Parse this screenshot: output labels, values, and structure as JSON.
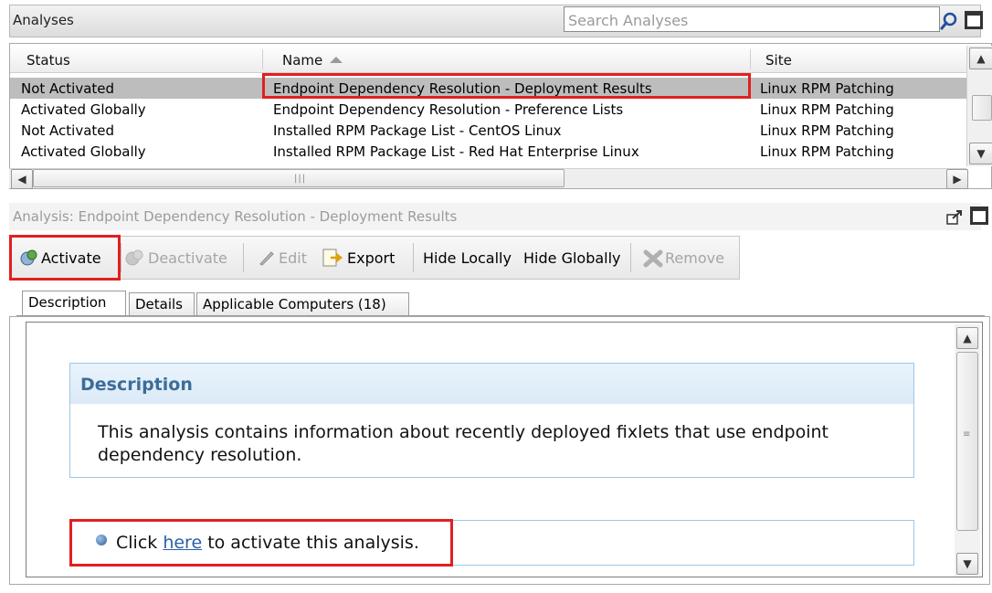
{
  "header": {
    "title": "Analyses",
    "search_placeholder": "Search Analyses"
  },
  "list": {
    "columns": [
      "Status",
      "Name",
      "Site"
    ],
    "rows": [
      {
        "status": "Not Activated",
        "name": "Endpoint Dependency Resolution - Deployment Results",
        "site": "Linux RPM Patching",
        "selected": true
      },
      {
        "status": "Activated Globally",
        "name": "Endpoint Dependency Resolution - Preference Lists",
        "site": "Linux RPM Patching",
        "selected": false
      },
      {
        "status": "Not Activated",
        "name": "Installed RPM Package List - CentOS Linux",
        "site": "Linux RPM Patching",
        "selected": false
      },
      {
        "status": "Activated Globally",
        "name": "Installed RPM Package List - Red Hat Enterprise Linux",
        "site": "Linux RPM Patching",
        "selected": false
      }
    ]
  },
  "analysis": {
    "title": "Analysis: Endpoint Dependency Resolution - Deployment Results"
  },
  "toolbar": {
    "activate": "Activate",
    "deactivate": "Deactivate",
    "edit": "Edit",
    "export": "Export",
    "hide_locally": "Hide Locally",
    "hide_globally": "Hide Globally",
    "remove": "Remove"
  },
  "tabs": [
    "Description",
    "Details",
    "Applicable Computers (18)"
  ],
  "description": {
    "heading": "Description",
    "body": "This analysis contains information about recently deployed fixlets that use endpoint dependency resolution.",
    "click_prefix": "Click ",
    "click_link": "here",
    "click_suffix": " to activate this analysis."
  },
  "colors": {
    "highlight": "#e02020",
    "selected_row": "#bdbdbd",
    "desc_heading": "#3d6d98",
    "link": "#2a5fa8"
  }
}
